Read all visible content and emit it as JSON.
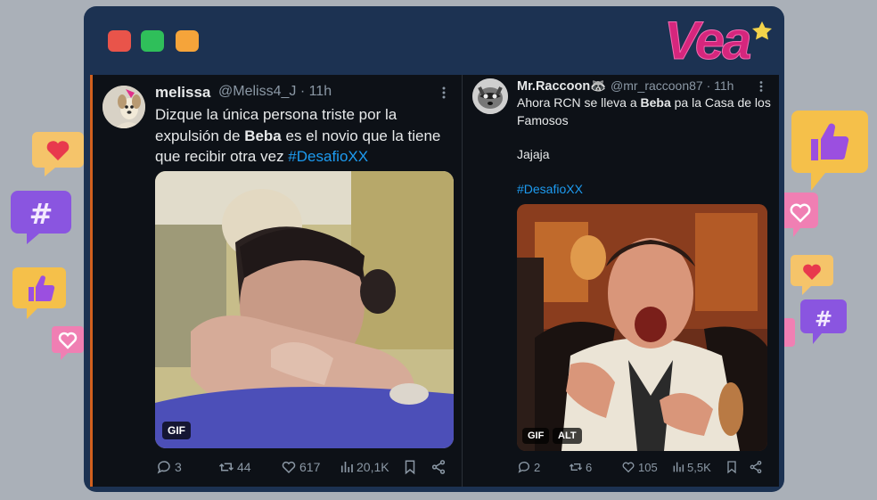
{
  "brand": {
    "logo_text": "Vea"
  },
  "window": {
    "controls": [
      "close",
      "minimize",
      "maximize"
    ]
  },
  "tweet_left": {
    "name": "melissa",
    "handle_time": "@Meliss4_J · 11h",
    "body_pre": "Dizque la única persona triste por la expulsión de ",
    "body_bold": "Beba",
    "body_post": " es el novio que la tiene que recibir otra vez ",
    "hashtag": "#DesafioXX",
    "media_badge": "GIF",
    "stats": {
      "replies": "3",
      "retweets": "44",
      "likes": "617",
      "views": "20,1K"
    }
  },
  "tweet_right": {
    "name": "Mr.Raccoon🦝",
    "handle_time": "@mr_raccoon87 · 11h",
    "body_pre": "Ahora RCN se lleva a ",
    "body_bold": "Beba",
    "body_post": " pa la Casa de los Famosos",
    "line2": "Jajaja",
    "hashtag": "#DesafioXX",
    "media_badge_1": "GIF",
    "media_badge_2": "ALT",
    "stats": {
      "replies": "2",
      "retweets": "6",
      "likes": "105",
      "views": "5,5K"
    }
  },
  "colors": {
    "frame": "#1c3252",
    "background": "#aab0b8",
    "tweet_bg": "#0d1117",
    "hashtag": "#1d9bf0",
    "logo": "#d6267d"
  },
  "icons": [
    "reply-icon",
    "retweet-icon",
    "like-icon",
    "views-icon",
    "bookmark-icon",
    "share-icon",
    "more-icon"
  ]
}
